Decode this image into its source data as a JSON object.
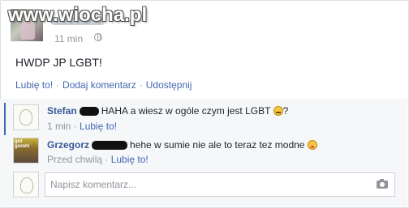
{
  "watermark": "www.wiocha.pl",
  "post": {
    "time": "11 min",
    "text": "HWDP JP LGBT!",
    "actions": [
      "Lubię to!",
      "Dodaj komentarz",
      "Udostępnij"
    ]
  },
  "comments": [
    {
      "author": "Stefan",
      "text": "HAHA a wiesz w ogóle czym jest LGBT",
      "after_emoji": "?",
      "emoji": "smile-emoji",
      "time": "1 min",
      "like": "Lubię to!"
    },
    {
      "author": "Grzegorz",
      "text": "hehe w sumie nie ale to teraz tez modne",
      "after_emoji": "",
      "emoji": "tongue-emoji",
      "time": "Przed chwilą",
      "like": "Lubię to!"
    }
  ],
  "composer": {
    "placeholder": "Napisz komentarz..."
  },
  "colors": {
    "link": "#4267b2",
    "name": "#365899",
    "meta": "#90949c",
    "comments_bg": "#f6f7f9"
  }
}
